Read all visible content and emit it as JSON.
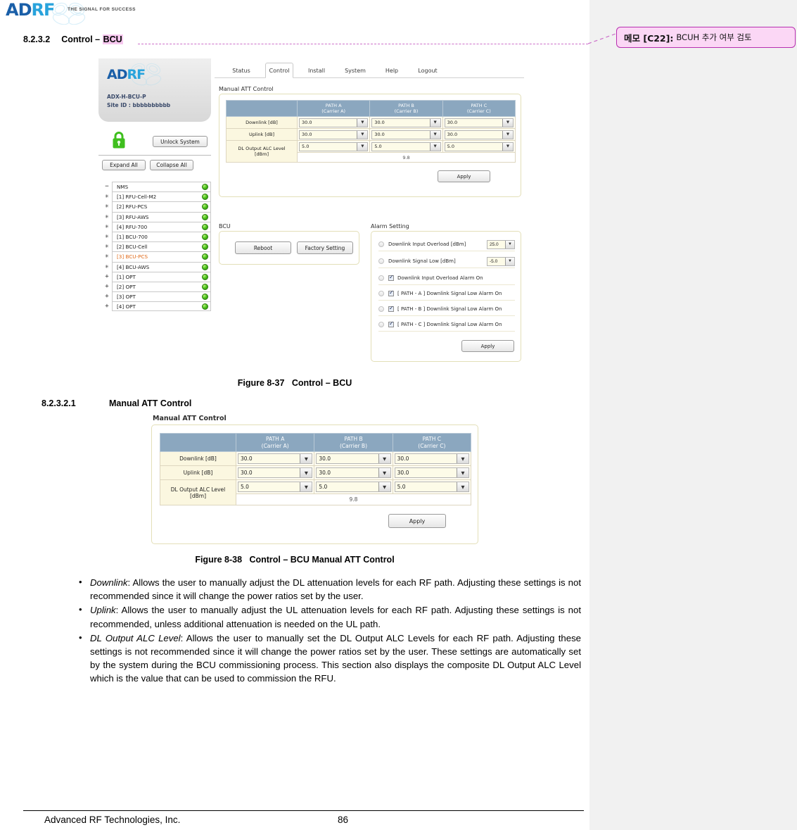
{
  "header": {
    "logo_ad": "AD",
    "logo_rf": "RF",
    "tagline": "THE SIGNAL FOR SUCCESS"
  },
  "comment": {
    "label": "메모 [C22]:",
    "text": "BCUH 추가 여부 검토"
  },
  "headings": {
    "h_8232_num": "8.2.3.2",
    "h_8232_text": "Control – ",
    "h_8232_highlight": "BCU",
    "h_82321_num": "8.2.3.2.1",
    "h_82321_text": "Manual ATT Control"
  },
  "figure_37": {
    "caption_num": "Figure 8-37",
    "caption_text": "Control – BCU",
    "device": {
      "logo_ad": "AD",
      "logo_rf": "RF",
      "model": "ADX-H-BCU-P",
      "site_id": "Site ID : bbbbbbbbbb"
    },
    "buttons": {
      "unlock": "Unlock System",
      "expand_all": "Expand All",
      "collapse_all": "Collapse All"
    },
    "tabs": [
      {
        "label": "Status",
        "active": false
      },
      {
        "label": "Control",
        "active": true
      },
      {
        "label": "Install",
        "active": false
      },
      {
        "label": "System",
        "active": false
      },
      {
        "label": "Help",
        "active": false
      },
      {
        "label": "Logout",
        "active": false
      }
    ],
    "tree": [
      {
        "expander": "−",
        "label": "NMS",
        "status": "green",
        "alert": false
      },
      {
        "expander": "✳",
        "label": "[1] RFU-Cell-M2",
        "status": "green",
        "alert": false
      },
      {
        "expander": "✳",
        "label": "[2] RFU-PCS",
        "status": "green",
        "alert": false
      },
      {
        "expander": "✳",
        "label": "[3] RFU-AWS",
        "status": "green",
        "alert": false
      },
      {
        "expander": "✳",
        "label": "[4] RFU-700",
        "status": "green",
        "alert": false
      },
      {
        "expander": "✳",
        "label": "[1] BCU-700",
        "status": "green",
        "alert": false
      },
      {
        "expander": "✳",
        "label": "[2] BCU-Cell",
        "status": "green",
        "alert": false
      },
      {
        "expander": "✳",
        "label": "[3] BCU-PCS",
        "status": "green",
        "alert": true
      },
      {
        "expander": "✳",
        "label": "[4] BCU-AWS",
        "status": "green",
        "alert": false
      },
      {
        "expander": "+",
        "label": "[1] OPT",
        "status": "green",
        "alert": false
      },
      {
        "expander": "+",
        "label": "[2] OPT",
        "status": "green",
        "alert": false
      },
      {
        "expander": "+",
        "label": "[3] OPT",
        "status": "green",
        "alert": false
      },
      {
        "expander": "+",
        "label": "[4] OPT",
        "status": "green",
        "alert": false
      }
    ],
    "manual_att": {
      "section_title": "Manual ATT Control",
      "columns": [
        {
          "top": "PATH A",
          "bottom": "(Carrier A)"
        },
        {
          "top": "PATH B",
          "bottom": "(Carrier B)"
        },
        {
          "top": "PATH C",
          "bottom": "(Carrier C)"
        }
      ],
      "rows": [
        {
          "label": "Downlink [dB]",
          "values": [
            "30.0",
            "30.0",
            "30.0"
          ]
        },
        {
          "label": "Uplink [dB]",
          "values": [
            "30.0",
            "30.0",
            "30.0"
          ]
        },
        {
          "label": "DL Output ALC Level [dBm]",
          "label_line1": "DL Output ALC Level",
          "label_line2": "[dBm]",
          "values": [
            "5.0",
            "5.0",
            "5.0"
          ]
        }
      ],
      "composite_value": "9.8",
      "apply_label": "Apply"
    },
    "bcu": {
      "section_title": "BCU",
      "reboot_label": "Reboot",
      "factory_label": "Factory Setting"
    },
    "alarm": {
      "section_title": "Alarm Setting",
      "fields": [
        {
          "label": "Downlink Input Overload [dBm]",
          "value": "25.0"
        },
        {
          "label": "Downlink Signal Low [dBm]",
          "value": "-5.0"
        }
      ],
      "checks": [
        {
          "label": "Downlink Input Overload Alarm On",
          "checked": true
        },
        {
          "label": "[ PATH - A ] Downlink Signal Low Alarm On",
          "checked": true
        },
        {
          "label": "[ PATH - B ] Downlink Signal Low Alarm On",
          "checked": true
        },
        {
          "label": "[ PATH - C ] Downlink Signal Low Alarm On",
          "checked": true
        }
      ],
      "apply_label": "Apply"
    }
  },
  "figure_38": {
    "caption_num": "Figure 8-38",
    "caption_text": "Control – BCU Manual ATT Control",
    "section_title": "Manual ATT Control",
    "columns": [
      {
        "top": "PATH A",
        "bottom": "(Carrier A)"
      },
      {
        "top": "PATH B",
        "bottom": "(Carrier B)"
      },
      {
        "top": "PATH C",
        "bottom": "(Carrier C)"
      }
    ],
    "rows": [
      {
        "label": "Downlink [dB]",
        "values": [
          "30.0",
          "30.0",
          "30.0"
        ]
      },
      {
        "label": "Uplink [dB]",
        "values": [
          "30.0",
          "30.0",
          "30.0"
        ]
      },
      {
        "label_line1": "DL Output ALC Level",
        "label_line2": "[dBm]",
        "values": [
          "5.0",
          "5.0",
          "5.0"
        ]
      }
    ],
    "composite_value": "9.8",
    "apply_label": "Apply"
  },
  "bullets": [
    {
      "term": "Downlink",
      "body": ": Allows the user to manually adjust the DL attenuation levels for each RF path.  Adjusting these settings is not recommended since it will change the power ratios set by the user."
    },
    {
      "term": "Uplink",
      "body": ": Allows the user to manually adjust the UL attenuation levels for each RF path.  Adjusting these settings is not recommended, unless additional attenuation is needed on the UL path."
    },
    {
      "term": "DL Output ALC Level",
      "body": ": Allows the user to manually set the DL Output ALC Levels for each RF path.  Adjusting these settings is not recommended since it will change the power ratios set by the user.  These settings are automatically set by the system during the BCU commissioning process.  This section also displays the composite DL Output ALC Level which is the value that can be used to commission the RFU."
    }
  ],
  "footer": {
    "company": "Advanced RF Technologies, Inc.",
    "page_number": "86"
  },
  "colors": {
    "brand_blue": "#1a5fa8",
    "brand_cyan": "#29a3dc",
    "table_header": "#8ba7bf",
    "highlight": "#f6c8ef",
    "comment_border": "#b72fb0",
    "alert_text": "#e06a1a",
    "led_green": "#4cc21c"
  }
}
